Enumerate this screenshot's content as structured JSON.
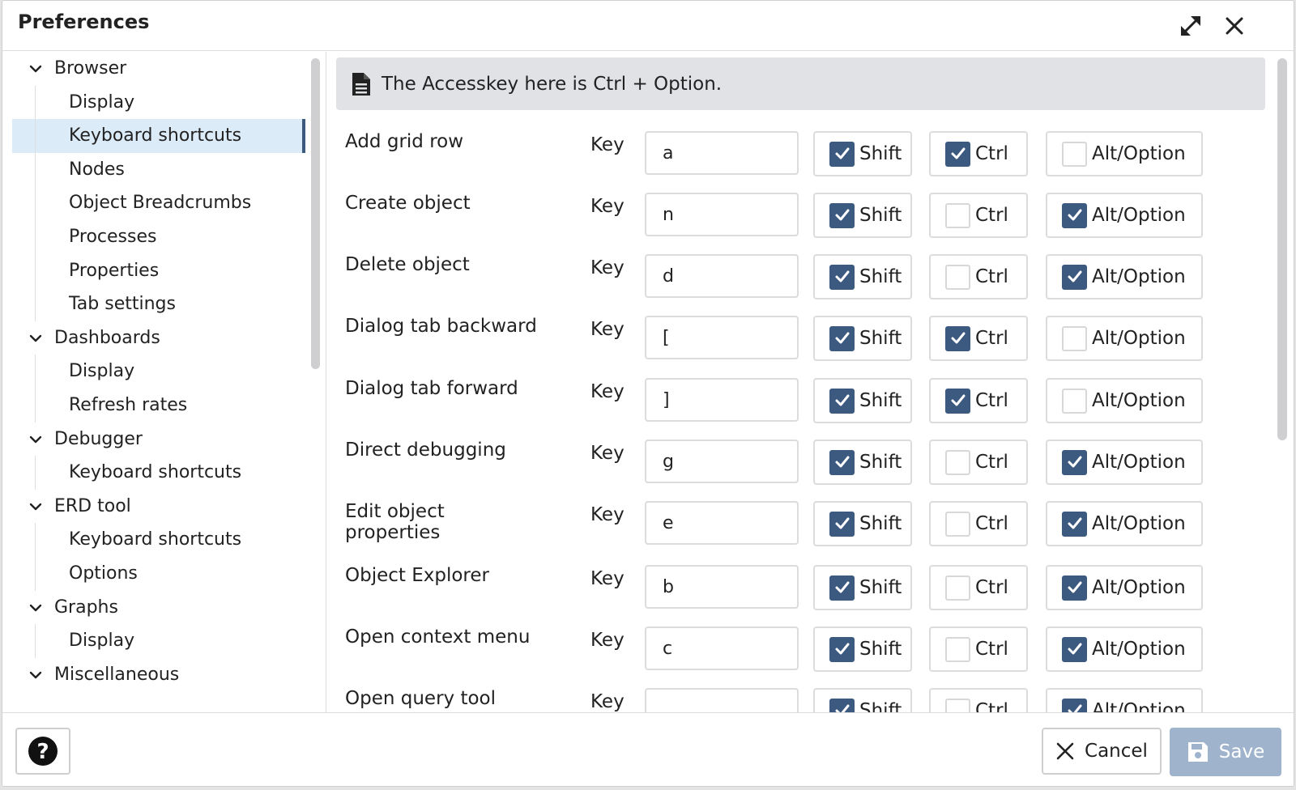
{
  "dialog": {
    "title": "Preferences",
    "maximize_icon": "maximize-icon",
    "close_icon": "close-icon"
  },
  "sidebar": {
    "items": [
      {
        "label": "Browser",
        "type": "group"
      },
      {
        "label": "Display",
        "type": "child"
      },
      {
        "label": "Keyboard shortcuts",
        "type": "child",
        "selected": true
      },
      {
        "label": "Nodes",
        "type": "child"
      },
      {
        "label": "Object Breadcrumbs",
        "type": "child"
      },
      {
        "label": "Processes",
        "type": "child"
      },
      {
        "label": "Properties",
        "type": "child"
      },
      {
        "label": "Tab settings",
        "type": "child"
      },
      {
        "label": "Dashboards",
        "type": "group"
      },
      {
        "label": "Display",
        "type": "child"
      },
      {
        "label": "Refresh rates",
        "type": "child"
      },
      {
        "label": "Debugger",
        "type": "group"
      },
      {
        "label": "Keyboard shortcuts",
        "type": "child"
      },
      {
        "label": "ERD tool",
        "type": "group"
      },
      {
        "label": "Keyboard shortcuts",
        "type": "child"
      },
      {
        "label": "Options",
        "type": "child"
      },
      {
        "label": "Graphs",
        "type": "group"
      },
      {
        "label": "Display",
        "type": "child"
      },
      {
        "label": "Miscellaneous",
        "type": "group"
      }
    ]
  },
  "info": {
    "icon": "document-icon",
    "text": "The Accesskey here is Ctrl + Option."
  },
  "labels": {
    "key": "Key",
    "shift": "Shift",
    "ctrl": "Ctrl",
    "alt": "Alt/Option"
  },
  "shortcuts": [
    {
      "name": "Add grid row",
      "key": "a",
      "shift": true,
      "ctrl": true,
      "alt": false
    },
    {
      "name": "Create object",
      "key": "n",
      "shift": true,
      "ctrl": false,
      "alt": true
    },
    {
      "name": "Delete object",
      "key": "d",
      "shift": true,
      "ctrl": false,
      "alt": true
    },
    {
      "name": "Dialog tab backward",
      "key": "[",
      "shift": true,
      "ctrl": true,
      "alt": false
    },
    {
      "name": "Dialog tab forward",
      "key": "]",
      "shift": true,
      "ctrl": true,
      "alt": false
    },
    {
      "name": "Direct debugging",
      "key": "g",
      "shift": true,
      "ctrl": false,
      "alt": true
    },
    {
      "name": "Edit object properties",
      "key": "e",
      "shift": true,
      "ctrl": false,
      "alt": true
    },
    {
      "name": "Object Explorer",
      "key": "b",
      "shift": true,
      "ctrl": false,
      "alt": true
    },
    {
      "name": "Open context menu",
      "key": "c",
      "shift": true,
      "ctrl": false,
      "alt": true
    },
    {
      "name": "Open query tool",
      "key": "",
      "shift": true,
      "ctrl": false,
      "alt": true
    }
  ],
  "footer": {
    "help_icon": "help-icon",
    "cancel_label": "Cancel",
    "save_label": "Save"
  },
  "colors": {
    "accent": "#3c5a80",
    "selected_bg": "#dcebf8",
    "info_bg": "#e0e2e6",
    "save_disabled": "#9fb4cc"
  }
}
